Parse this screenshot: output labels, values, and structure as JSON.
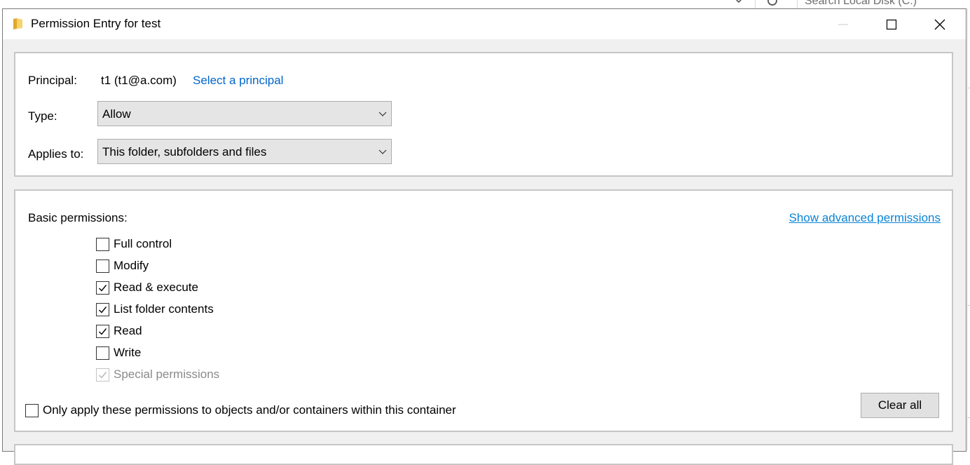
{
  "background": {
    "search_placeholder": "Search Local Disk (C:)"
  },
  "window": {
    "title": "Permission Entry for test",
    "icon": "folder-icon",
    "controls": [
      "minimize-icon",
      "maximize-icon",
      "close-icon"
    ]
  },
  "principal": {
    "label": "Principal:",
    "value": "t1 (t1@a.com)",
    "link": "Select a principal"
  },
  "type": {
    "label": "Type:",
    "selected": "Allow"
  },
  "applies_to": {
    "label": "Applies to:",
    "selected": "This folder, subfolders and files"
  },
  "permissions": {
    "heading": "Basic permissions:",
    "advanced_link": "Show advanced permissions",
    "items": [
      {
        "label": "Full control",
        "checked": false,
        "disabled": false
      },
      {
        "label": "Modify",
        "checked": false,
        "disabled": false
      },
      {
        "label": "Read & execute",
        "checked": true,
        "disabled": false
      },
      {
        "label": "List folder contents",
        "checked": true,
        "disabled": false
      },
      {
        "label": "Read",
        "checked": true,
        "disabled": false
      },
      {
        "label": "Write",
        "checked": false,
        "disabled": false
      },
      {
        "label": "Special permissions",
        "checked": true,
        "disabled": true
      }
    ],
    "only_apply_label": "Only apply these permissions to objects and/or containers within this container",
    "only_apply_checked": false,
    "clear_all_label": "Clear all"
  },
  "colors": {
    "link": "#0066cc",
    "dialog_bg": "#f0f0f0",
    "panel_border": "#c6c6c6"
  }
}
